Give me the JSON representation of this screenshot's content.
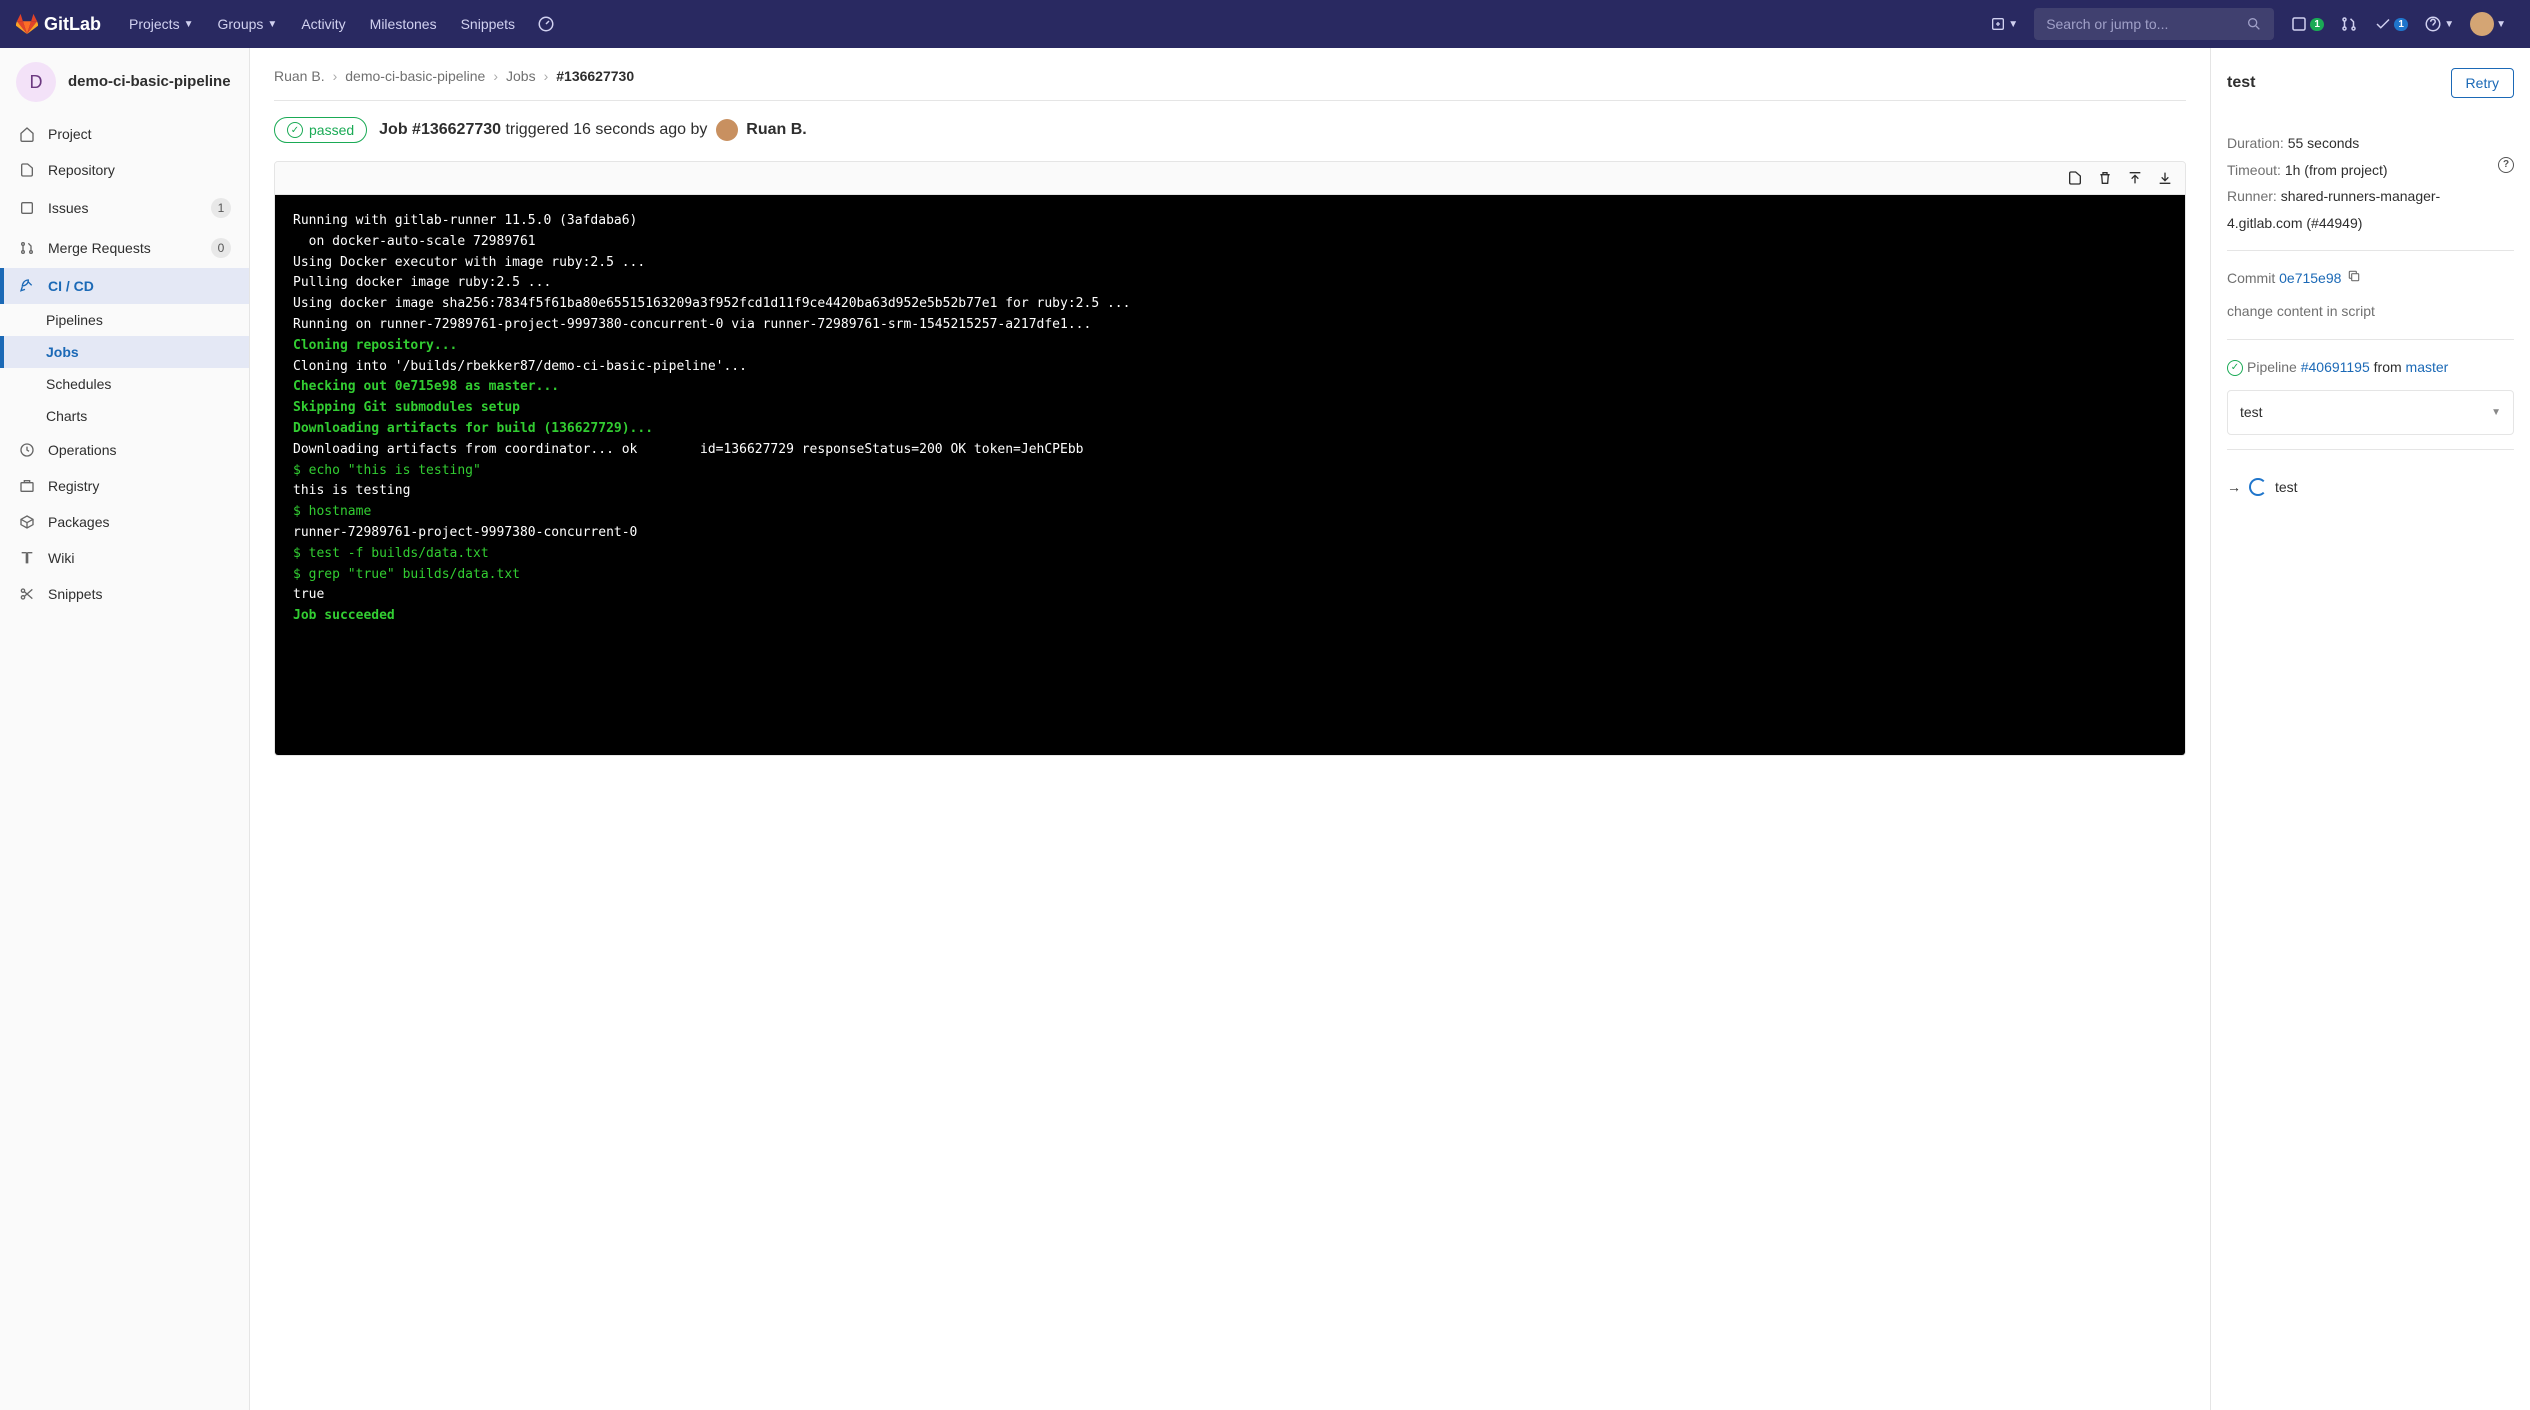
{
  "topnav": {
    "brand": "GitLab",
    "items": [
      "Projects",
      "Groups",
      "Activity",
      "Milestones",
      "Snippets"
    ],
    "search_placeholder": "Search or jump to...",
    "issues_badge": "1",
    "todos_badge": "1"
  },
  "sidebar": {
    "project_initial": "D",
    "project_name": "demo-ci-basic-pipeline",
    "items": {
      "project": "Project",
      "repository": "Repository",
      "issues": "Issues",
      "issues_count": "1",
      "merge_requests": "Merge Requests",
      "merge_requests_count": "0",
      "cicd": "CI / CD",
      "operations": "Operations",
      "registry": "Registry",
      "packages": "Packages",
      "wiki": "Wiki",
      "snippets": "Snippets"
    },
    "cicd_sub": {
      "pipelines": "Pipelines",
      "jobs": "Jobs",
      "schedules": "Schedules",
      "charts": "Charts"
    }
  },
  "breadcrumb": {
    "owner": "Ruan B.",
    "project": "demo-ci-basic-pipeline",
    "section": "Jobs",
    "current": "#136627730"
  },
  "job": {
    "status": "passed",
    "title_prefix": "Job ",
    "title_id": "#136627730",
    "triggered_text": " triggered 16 seconds ago by ",
    "user": "Ruan B."
  },
  "log": [
    {
      "c": "w",
      "t": "Running with gitlab-runner 11.5.0 (3afdaba6)"
    },
    {
      "c": "w",
      "t": "  on docker-auto-scale 72989761"
    },
    {
      "c": "w",
      "t": "Using Docker executor with image ruby:2.5 ..."
    },
    {
      "c": "w",
      "t": "Pulling docker image ruby:2.5 ..."
    },
    {
      "c": "w",
      "t": "Using docker image sha256:7834f5f61ba80e65515163209a3f952fcd1d11f9ce4420ba63d952e5b52b77e1 for ruby:2.5 ..."
    },
    {
      "c": "w",
      "t": "Running on runner-72989761-project-9997380-concurrent-0 via runner-72989761-srm-1545215257-a217dfe1..."
    },
    {
      "c": "g",
      "t": "Cloning repository..."
    },
    {
      "c": "w",
      "t": "Cloning into '/builds/rbekker87/demo-ci-basic-pipeline'..."
    },
    {
      "c": "g",
      "t": "Checking out 0e715e98 as master..."
    },
    {
      "c": "g",
      "t": "Skipping Git submodules setup"
    },
    {
      "c": "g",
      "t": "Downloading artifacts for build (136627729)..."
    },
    {
      "c": "w",
      "t": "Downloading artifacts from coordinator... ok        id=136627729 responseStatus=200 OK token=JehCPEbb"
    },
    {
      "c": "gc",
      "t": "$ echo \"this is testing\""
    },
    {
      "c": "w",
      "t": "this is testing"
    },
    {
      "c": "gc",
      "t": "$ hostname"
    },
    {
      "c": "w",
      "t": "runner-72989761-project-9997380-concurrent-0"
    },
    {
      "c": "gc",
      "t": "$ test -f builds/data.txt"
    },
    {
      "c": "gc",
      "t": "$ grep \"true\" builds/data.txt"
    },
    {
      "c": "w",
      "t": "true"
    },
    {
      "c": "g",
      "t": "Job succeeded"
    }
  ],
  "right": {
    "title": "test",
    "retry": "Retry",
    "duration_label": "Duration:",
    "duration_value": "55 seconds",
    "timeout_label": "Timeout:",
    "timeout_value": "1h (from project)",
    "runner_label": "Runner:",
    "runner_value": "shared-runners-manager-4.gitlab.com (#44949)",
    "commit_label": "Commit",
    "commit_sha": "0e715e98",
    "commit_msg": "change content in script",
    "pipeline_label": "Pipeline",
    "pipeline_id": "#40691195",
    "pipeline_from": "from",
    "pipeline_branch": "master",
    "stage": "test",
    "current_job": "test"
  }
}
